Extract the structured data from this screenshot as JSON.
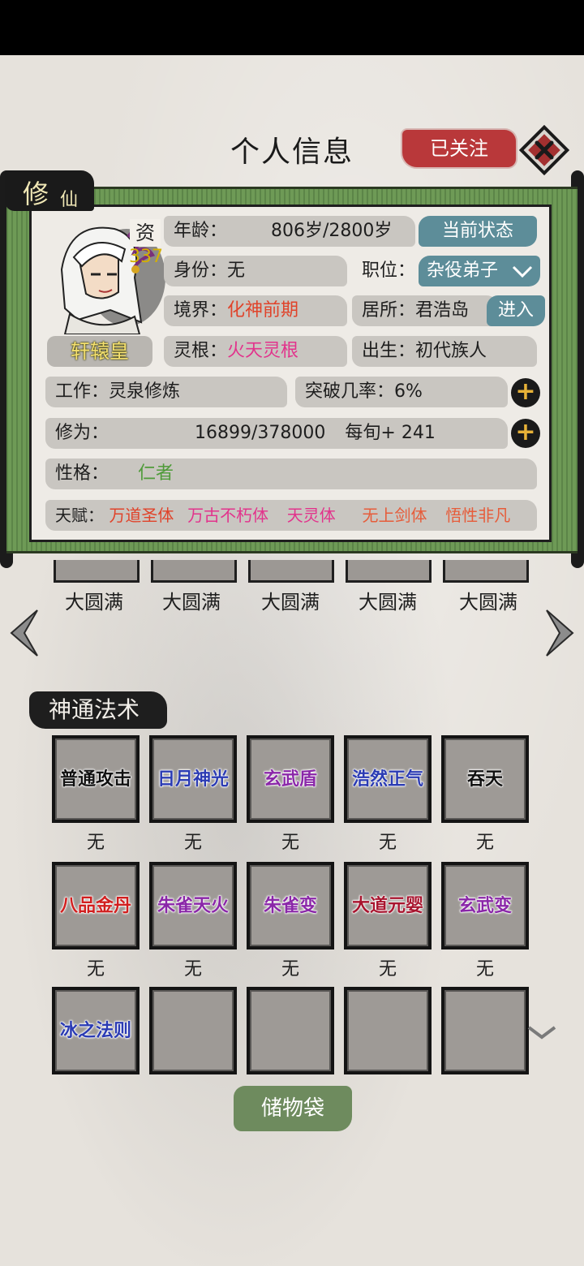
{
  "header": {
    "title": "个人信息",
    "follow_label": "已关注"
  },
  "profile": {
    "tag_main": "修",
    "tag_sub": "仙",
    "aptitude_label": "资",
    "aptitude_value": "337",
    "name": "轩辕皇",
    "age_label": "年龄：",
    "age_value": "806岁/2800岁",
    "status_button": "当前状态",
    "identity_label": "身份：",
    "identity_value": "无",
    "position_label": "职位：",
    "position_value": "杂役弟子",
    "realm_label": "境界：",
    "realm_value": "化神前期",
    "residence_label": "居所：",
    "residence_value": "君浩岛",
    "enter_button": "进入",
    "root_label": "灵根：",
    "root_value": "火天灵根",
    "birth_label": "出生：",
    "birth_value": "初代族人",
    "work_label": "工作：",
    "work_value": "灵泉修炼",
    "breakthrough_label": "突破几率：",
    "breakthrough_value": "6%",
    "cultivation_label": "修为：",
    "cultivation_value": "16899/378000",
    "per_turn_label": "每旬+",
    "per_turn_value": "241",
    "personality_label": "性格：",
    "personality_value": "仁者",
    "talent_label": "天赋：",
    "talents": [
      "万道圣体",
      "万古不朽体",
      "天灵体",
      "无上剑体",
      "悟性非凡"
    ],
    "colors": {
      "aptitude": "#d4b000",
      "red": "#e0432a",
      "pink": "#e2338c",
      "green": "#4f9b3a"
    }
  },
  "realm_levels": [
    "大圆满",
    "大圆满",
    "大圆满",
    "大圆满",
    "大圆满"
  ],
  "skills_section": {
    "title": "神通法术",
    "rows": [
      [
        {
          "name": "普通攻击",
          "level": "无",
          "color": "black"
        },
        {
          "name": "日月神光",
          "level": "无",
          "color": "blue"
        },
        {
          "name": "玄武盾",
          "level": "无",
          "color": "purple"
        },
        {
          "name": "浩然正气",
          "level": "无",
          "color": "blue"
        },
        {
          "name": "吞天",
          "level": "无",
          "color": "black"
        }
      ],
      [
        {
          "name": "八品金丹",
          "level": "无",
          "color": "red"
        },
        {
          "name": "朱雀天火",
          "level": "无",
          "color": "purple"
        },
        {
          "name": "朱雀变",
          "level": "无",
          "color": "purple"
        },
        {
          "name": "大道元婴",
          "level": "无",
          "color": "crimson"
        },
        {
          "name": "玄武变",
          "level": "无",
          "color": "purple"
        }
      ],
      [
        {
          "name": "冰之法则",
          "level": "",
          "color": "blue"
        },
        {
          "name": "",
          "level": "",
          "color": "black"
        },
        {
          "name": "",
          "level": "",
          "color": "black"
        },
        {
          "name": "",
          "level": "",
          "color": "black"
        },
        {
          "name": "",
          "level": "",
          "color": "black"
        }
      ]
    ]
  },
  "bag_button": "储物袋"
}
